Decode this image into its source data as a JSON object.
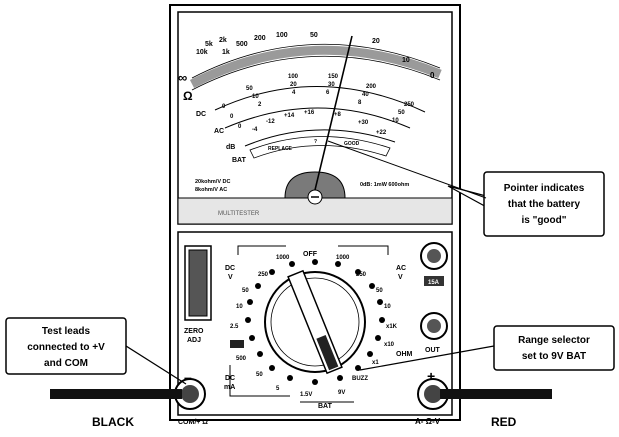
{
  "meter": {
    "ohm_scale": [
      "∞",
      "10k",
      "5k",
      "2k",
      "1k",
      "500",
      "200",
      "100",
      "50",
      "20",
      "10",
      "0"
    ],
    "ohm_mid": [
      "Ω"
    ],
    "dc_labels": [
      "DC",
      "AC",
      "dB",
      "BAT"
    ],
    "volt_scale_outer": [
      "0",
      "50",
      "100",
      "150",
      "200",
      "250"
    ],
    "volt_scale_mid": [
      "0",
      "10",
      "20",
      "30",
      "40",
      "50"
    ],
    "volt_scale_inner": [
      "0",
      "2",
      "4",
      "6",
      "8",
      "10"
    ],
    "db_scale": [
      "-4",
      "-12",
      "+14",
      "+16",
      "+8",
      "+30",
      "+22"
    ],
    "bat_scale": [
      "REPLACE",
      "?",
      "GOOD"
    ],
    "sensitivity_dc": "20kohm/V DC",
    "sensitivity_ac": "8kohm/V AC",
    "sensitivity_right": "0dB: 1mW 600ohm",
    "brand": "MULTITESTER"
  },
  "dial": {
    "top_labels": [
      "OFF",
      "1000",
      "1000"
    ],
    "left_labels": [
      "DC",
      "V",
      "250",
      "50",
      "10",
      "2.5"
    ],
    "right_labels": [
      "AC",
      "V",
      "250",
      "50",
      "10",
      "x1K",
      "x10",
      "x1",
      "OHM"
    ],
    "bottom_labels": [
      "500",
      "DC",
      "mA",
      "50",
      "5",
      "1.5V",
      "9V",
      "BAT",
      "BUZZ"
    ],
    "zero_adj": [
      "ZERO",
      "ADJ"
    ],
    "jack_15a": "15A",
    "jack_out": "OUT",
    "com_label": "COM/+ Ω",
    "pos_label": "A- Ω-V",
    "minus": "–",
    "plus": "+"
  },
  "callouts": {
    "pointer": [
      "Pointer indicates",
      "that the battery",
      "is \"good\""
    ],
    "test_leads": [
      "Test leads",
      "connected to +V",
      "and COM"
    ],
    "range": [
      "Range selector",
      "set to 9V BAT"
    ]
  },
  "leads": {
    "black": "BLACK",
    "red": "RED"
  }
}
